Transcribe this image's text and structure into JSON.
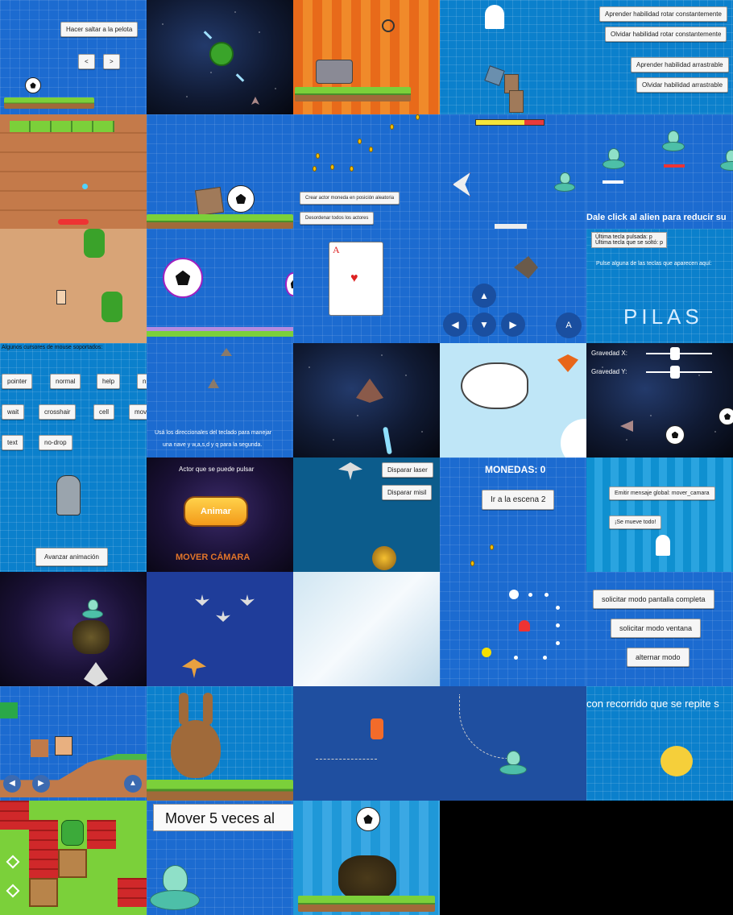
{
  "tiles": {
    "t01": {
      "buttons": [
        "Hacer saltar a la pelota",
        "<",
        ">"
      ]
    },
    "t05": {
      "buttons": [
        "Aprender habilidad rotar constantemente",
        "Olvidar habilidad rotar constantemente",
        "Aprender habilidad arrastrable",
        "Olvidar habilidad arrastrable"
      ]
    },
    "t08": {
      "buttons": [
        "Crear actor moneda en posición aleatoria",
        "Desordenar todos los actores"
      ]
    },
    "t10": {
      "caption": "Dale click al alien para reducir su"
    },
    "t14": {
      "arrows": [
        "▲",
        "◀",
        "▼",
        "▶"
      ],
      "a_button": "A"
    },
    "t15": {
      "last_pressed": "Última tecla pulsada: p",
      "last_released": "Última tecla que se soltó: p",
      "instruction": "Pulse alguna de las teclas que aparecen aquí:",
      "word": "PILAS"
    },
    "t16": {
      "title": "Algunos cursores de mouse soportados:",
      "cursors": [
        "pointer",
        "normal",
        "help",
        "n",
        "wait",
        "crosshair",
        "cell",
        "mov",
        "text",
        "no-drop"
      ]
    },
    "t17": {
      "caption_line1": "Usá los direccionales del teclado para manejar",
      "caption_line2": "una nave y w,a,s,d y q para la segunda."
    },
    "t20": {
      "gravity_x": "Gravedad X:",
      "gravity_y": "Gravedad Y:"
    },
    "t21": {
      "button": "Avanzar animación"
    },
    "t22": {
      "title": "Actor que se puede pulsar",
      "button": "Animar",
      "footer": "MOVER CÁMARA"
    },
    "t23": {
      "buttons": [
        "Disparar laser",
        "Disparar misil"
      ]
    },
    "t24": {
      "coins_label": "MONEDAS: 0",
      "button": "Ir a la escena 2"
    },
    "t25": {
      "buttons": [
        "Emitir mensaje global: mover_camara",
        "¡Se mueve todo!"
      ]
    },
    "t30": {
      "buttons": [
        "solicitar modo pantalla completa",
        "solicitar modo ventana",
        "alternar modo"
      ]
    },
    "t35": {
      "caption": "con recorrido que se repite s"
    },
    "t37": {
      "caption": "Mover 5 veces al"
    }
  },
  "colors": {
    "blueprint": "#1c6bd0",
    "grass": "#7bd03a",
    "orange": "#e66a1a",
    "dirt": "#c47a4a",
    "sand": "#d8a477",
    "sky": "#bfe6f7"
  }
}
